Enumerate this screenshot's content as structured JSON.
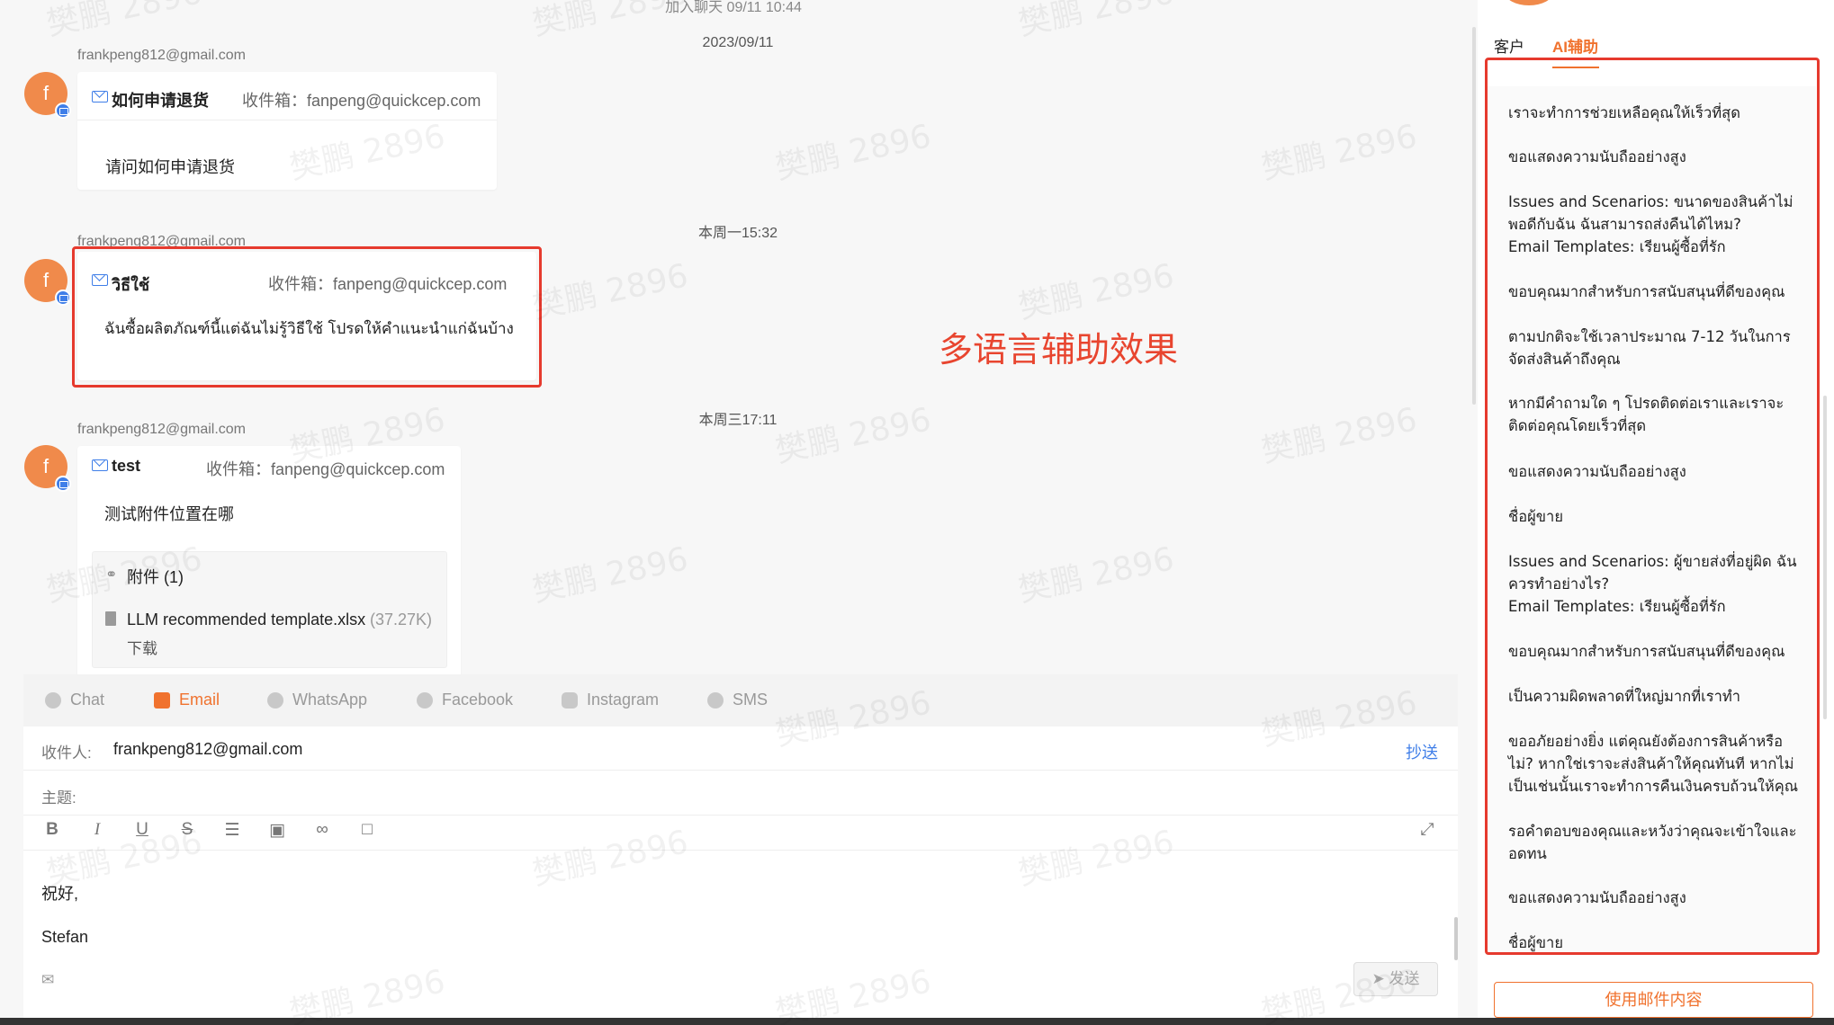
{
  "chat": {
    "top_join_text": "加入聊天 09/11 10:44",
    "messages": [
      {
        "date": "2023/09/11",
        "sender": "frankpeng812@gmail.com",
        "avatar": "f",
        "subject": "如何申请退货",
        "inbox": "收件箱：fanpeng@quickcep.com",
        "body": "请问如何申请退货"
      },
      {
        "date": "本周一15:32",
        "sender": "frankpeng812@gmail.com",
        "avatar": "f",
        "subject": "วิธีใช้",
        "inbox": "收件箱：fanpeng@quickcep.com",
        "body": "ฉันซื้อผลิตภัณฑ์นี้แต่ฉันไม่รู้วิธีใช้ โปรดให้คำแนะนำแก่ฉันบ้าง"
      },
      {
        "date": "本周三17:11",
        "sender": "frankpeng812@gmail.com",
        "avatar": "f",
        "subject": "test",
        "inbox": "收件箱：fanpeng@quickcep.com",
        "body": "测试附件位置在哪",
        "attachments_title": "附件 (1)",
        "attachment_name": "LLM recommended template.xlsx",
        "attachment_size": "(37.27K)",
        "download_label": "下载"
      }
    ],
    "annotation": "多语言辅助效果",
    "watermark": "樊鹏 2896"
  },
  "compose": {
    "channels": [
      {
        "label": "Chat",
        "icon": "chat-icon",
        "active": false
      },
      {
        "label": "Email",
        "icon": "email-icon",
        "active": true
      },
      {
        "label": "WhatsApp",
        "icon": "whatsapp-icon",
        "active": false
      },
      {
        "label": "Facebook",
        "icon": "messenger-icon",
        "active": false
      },
      {
        "label": "Instagram",
        "icon": "instagram-icon",
        "active": false
      },
      {
        "label": "SMS",
        "icon": "sms-icon",
        "active": false
      }
    ],
    "recipient_label": "收件人:",
    "recipient_value": "frankpeng812@gmail.com",
    "cc_label": "抄送",
    "subject_label": "主题:",
    "body_lines": [
      "祝好,",
      "Stefan"
    ],
    "send_label": "发送"
  },
  "sidebar": {
    "tabs": [
      {
        "label": "客户",
        "active": false
      },
      {
        "label": "AI辅助",
        "active": true
      }
    ],
    "ai_items": [
      "เราจะทำการช่วยเหลือคุณให้เร็วที่สุด",
      "ขอแสดงความนับถืออย่างสูง",
      "Issues and Scenarios: ขนาดของสินค้าไม่พอดีกับฉัน ฉันสามารถส่งคืนได้ไหม?\nEmail Templates: เรียนผู้ซื้อที่รัก",
      "ขอบคุณมากสำหรับการสนับสนุนที่ดีของคุณ",
      "ตามปกติจะใช้เวลาประมาณ 7-12 วันในการจัดส่งสินค้าถึงคุณ",
      "หากมีคำถามใด ๆ โปรดติดต่อเราและเราจะติดต่อคุณโดยเร็วที่สุด",
      "ขอแสดงความนับถืออย่างสูง",
      "ชื่อผู้ขาย",
      "Issues and Scenarios: ผู้ขายส่งที่อยู่ผิด ฉันควรทำอย่างไร?\nEmail Templates: เรียนผู้ซื้อที่รัก",
      "ขอบคุณมากสำหรับการสนับสนุนที่ดีของคุณ",
      "เป็นความผิดพลาดที่ใหญ่มากที่เราทำ",
      "ขออภัยอย่างยิ่ง แต่คุณยังต้องการสินค้าหรือไม่? หากใช่เราจะส่งสินค้าให้คุณทันที หากไม่เป็นเช่นนั้นเราจะทำการคืนเงินครบถ้วนให้คุณ",
      "รอคำตอบของคุณและหวังว่าคุณจะเข้าใจและอดทน",
      "ขอแสดงความนับถืออย่างสูง",
      "ชื่อผู้ขาย"
    ],
    "use_button": "使用邮件内容"
  },
  "colors": {
    "accent": "#f0722e",
    "highlight_box": "#e63a2e",
    "avatar": "#f08a4b",
    "link": "#3f7ee8"
  }
}
